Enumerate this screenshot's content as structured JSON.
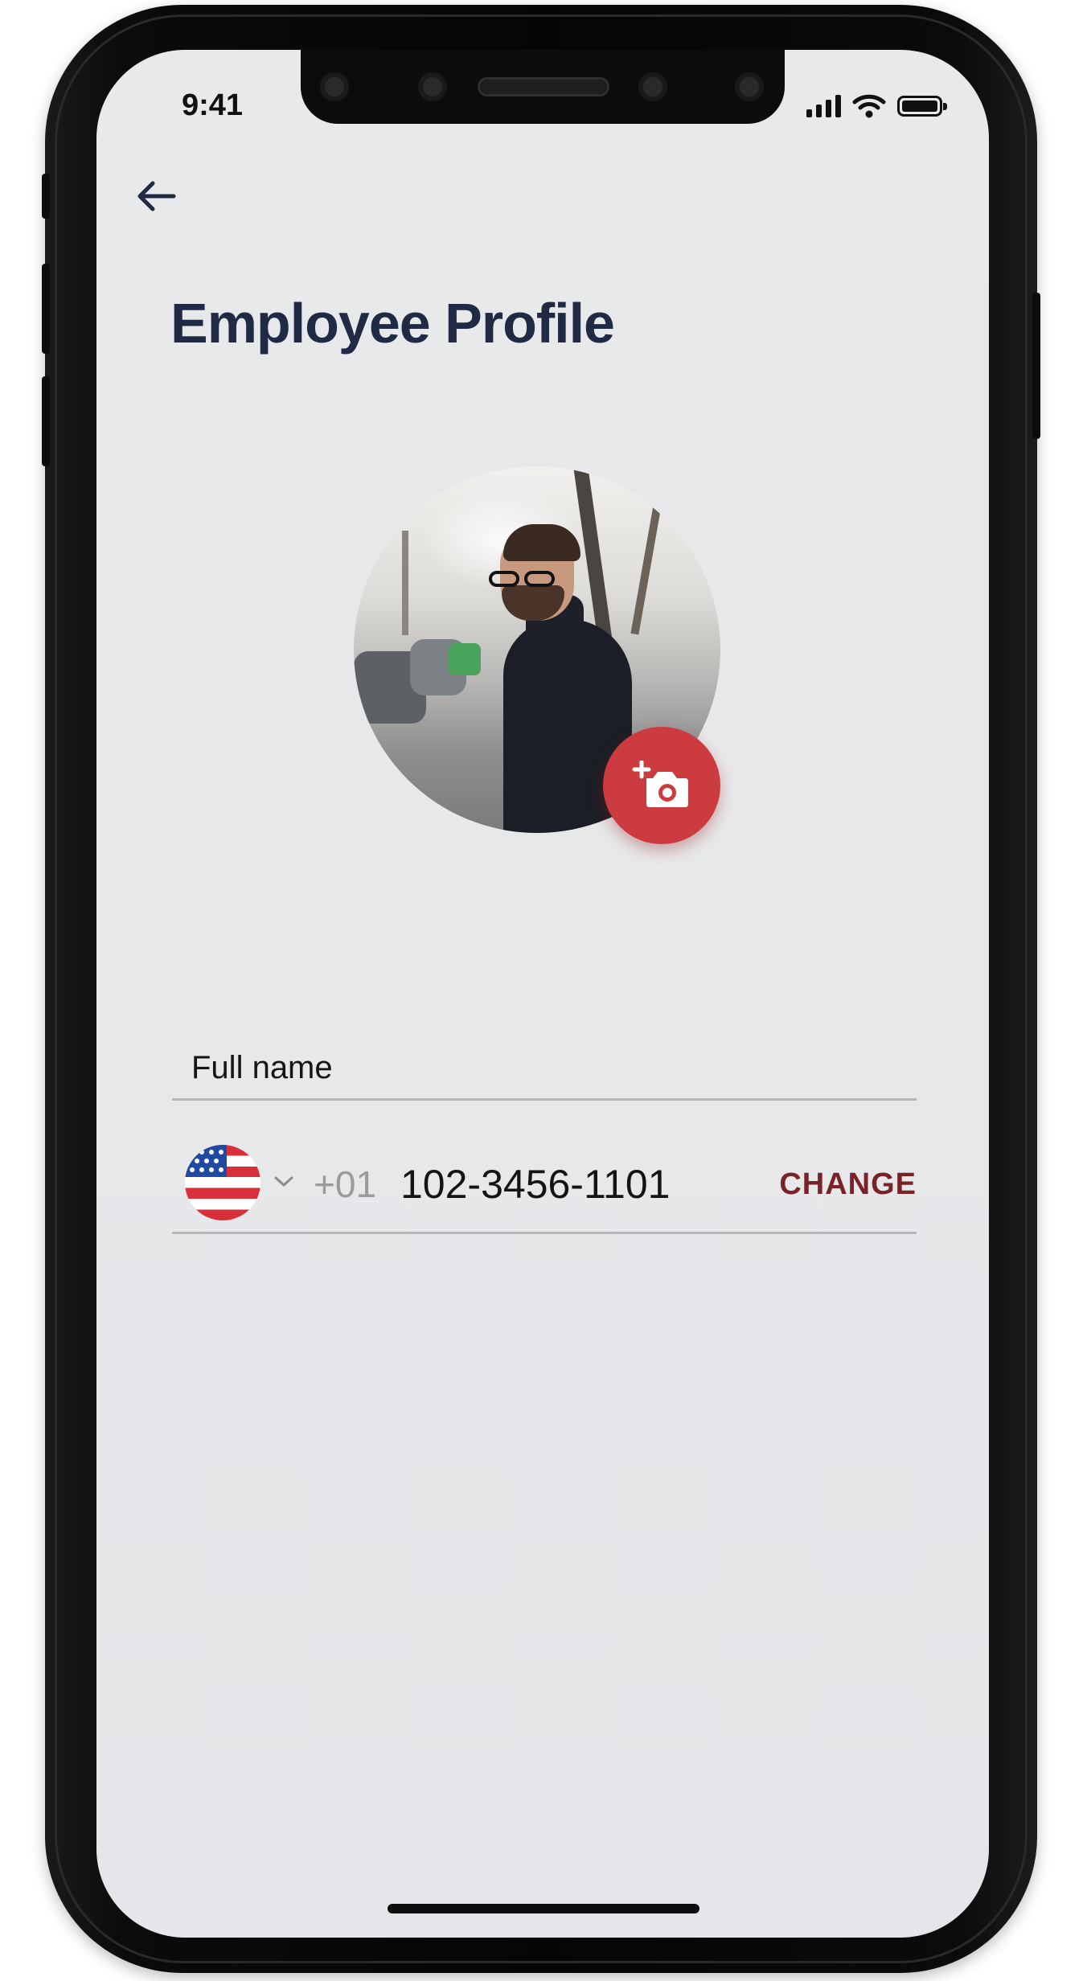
{
  "status_bar": {
    "time": "9:41",
    "icons": [
      "signal-icon",
      "wifi-icon",
      "battery-icon"
    ]
  },
  "header": {
    "back_icon": "arrow-left-icon",
    "title": "Employee Profile"
  },
  "profile_photo": {
    "action_icon": "add-photo-camera-icon",
    "action_color": "#cc3b3f"
  },
  "form": {
    "full_name_placeholder": "Full name",
    "phone": {
      "country_flag": "us-flag-icon",
      "dropdown_icon": "chevron-down-icon",
      "prefix": "+01",
      "number": "102-3456-1101",
      "change_label": "CHANGE"
    }
  },
  "colors": {
    "title": "#212a44",
    "accent": "#cc3b3f",
    "change_text": "#7a2228",
    "screen_bg": "#e8e9eb"
  }
}
